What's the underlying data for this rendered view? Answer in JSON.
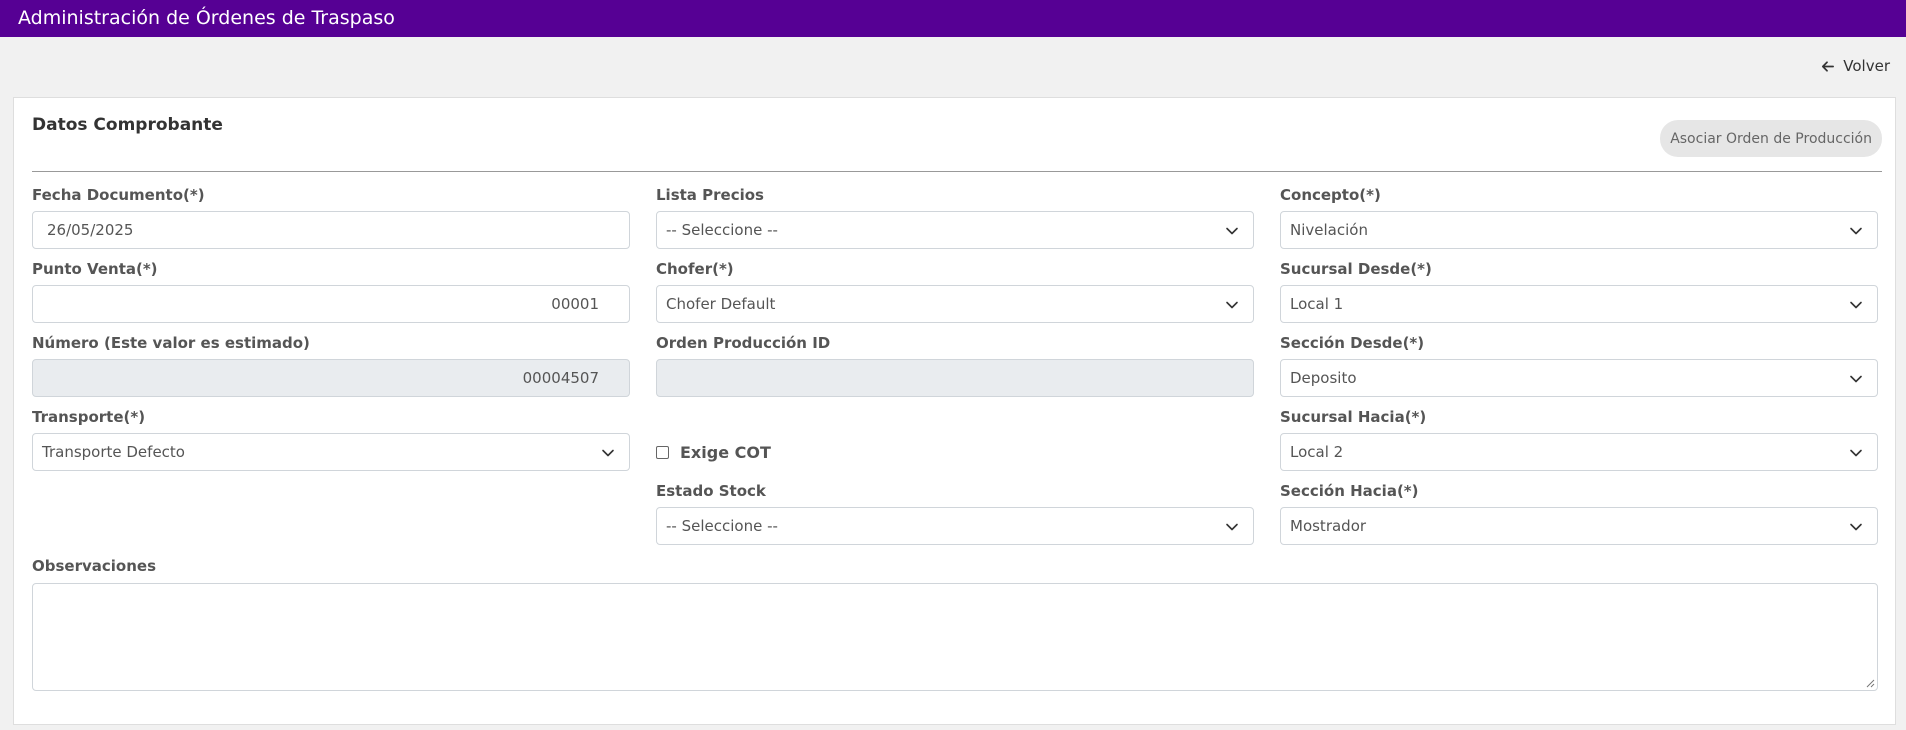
{
  "header": {
    "title": "Administración de Órdenes de Traspaso"
  },
  "nav": {
    "back_label": "Volver"
  },
  "card": {
    "title": "Datos Comprobante",
    "assoc_button": "Asociar Orden de Producción"
  },
  "form": {
    "fecha": {
      "label": "Fecha Documento(*)",
      "value": "26/05/2025"
    },
    "punto_venta": {
      "label": "Punto Venta(*)",
      "value": "00001"
    },
    "numero": {
      "label": "Número (Este valor es estimado)",
      "value": "00004507"
    },
    "transporte": {
      "label": "Transporte(*)",
      "value": "Transporte Defecto"
    },
    "lista_precios": {
      "label": "Lista Precios",
      "value": "-- Seleccione --"
    },
    "chofer": {
      "label": "Chofer(*)",
      "value": "Chofer Default"
    },
    "orden_produccion": {
      "label": "Orden Producción ID",
      "value": ""
    },
    "exige_cot": {
      "label": "Exige COT",
      "checked": false
    },
    "estado_stock": {
      "label": "Estado Stock",
      "value": "-- Seleccione --"
    },
    "concepto": {
      "label": "Concepto(*)",
      "value": "Nivelación"
    },
    "sucursal_desde": {
      "label": "Sucursal Desde(*)",
      "value": "Local 1"
    },
    "seccion_desde": {
      "label": "Sección Desde(*)",
      "value": "Deposito"
    },
    "sucursal_hacia": {
      "label": "Sucursal Hacia(*)",
      "value": "Local 2"
    },
    "seccion_hacia": {
      "label": "Sección Hacia(*)",
      "value": "Mostrador"
    },
    "observaciones": {
      "label": "Observaciones",
      "value": ""
    }
  },
  "colors": {
    "header_bg": "#560094",
    "page_bg": "#f1f1f1",
    "disabled_bg": "#e9ecef"
  }
}
